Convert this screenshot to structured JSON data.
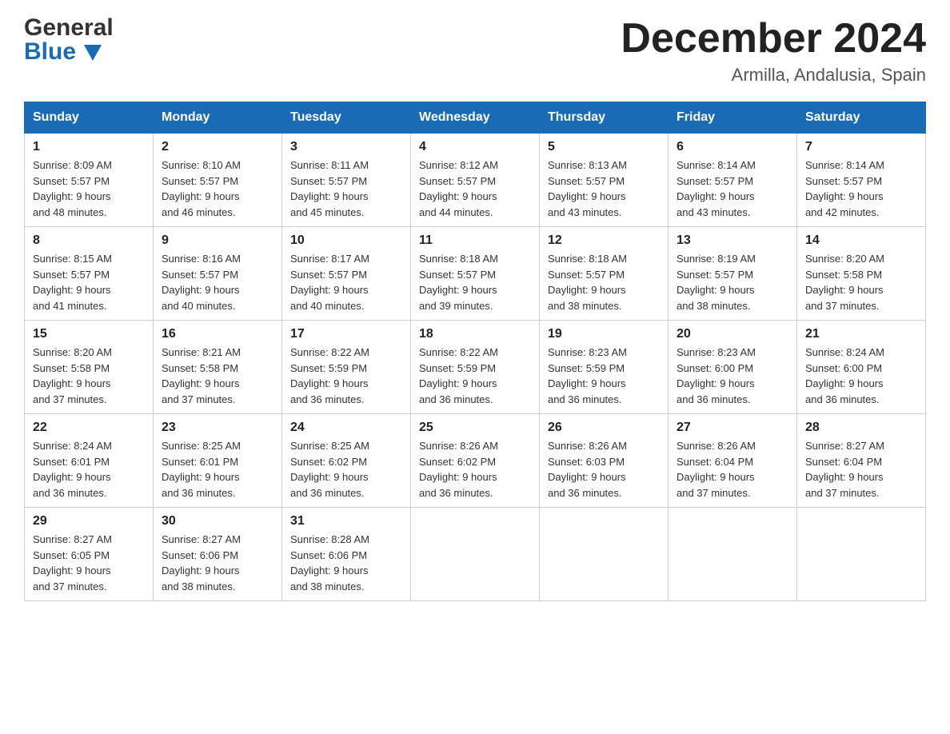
{
  "logo": {
    "line1": "General",
    "line2": "Blue"
  },
  "title": "December 2024",
  "subtitle": "Armilla, Andalusia, Spain",
  "days_of_week": [
    "Sunday",
    "Monday",
    "Tuesday",
    "Wednesday",
    "Thursday",
    "Friday",
    "Saturday"
  ],
  "weeks": [
    [
      {
        "day": "1",
        "sunrise": "8:09 AM",
        "sunset": "5:57 PM",
        "daylight": "9 hours and 48 minutes."
      },
      {
        "day": "2",
        "sunrise": "8:10 AM",
        "sunset": "5:57 PM",
        "daylight": "9 hours and 46 minutes."
      },
      {
        "day": "3",
        "sunrise": "8:11 AM",
        "sunset": "5:57 PM",
        "daylight": "9 hours and 45 minutes."
      },
      {
        "day": "4",
        "sunrise": "8:12 AM",
        "sunset": "5:57 PM",
        "daylight": "9 hours and 44 minutes."
      },
      {
        "day": "5",
        "sunrise": "8:13 AM",
        "sunset": "5:57 PM",
        "daylight": "9 hours and 43 minutes."
      },
      {
        "day": "6",
        "sunrise": "8:14 AM",
        "sunset": "5:57 PM",
        "daylight": "9 hours and 43 minutes."
      },
      {
        "day": "7",
        "sunrise": "8:14 AM",
        "sunset": "5:57 PM",
        "daylight": "9 hours and 42 minutes."
      }
    ],
    [
      {
        "day": "8",
        "sunrise": "8:15 AM",
        "sunset": "5:57 PM",
        "daylight": "9 hours and 41 minutes."
      },
      {
        "day": "9",
        "sunrise": "8:16 AM",
        "sunset": "5:57 PM",
        "daylight": "9 hours and 40 minutes."
      },
      {
        "day": "10",
        "sunrise": "8:17 AM",
        "sunset": "5:57 PM",
        "daylight": "9 hours and 40 minutes."
      },
      {
        "day": "11",
        "sunrise": "8:18 AM",
        "sunset": "5:57 PM",
        "daylight": "9 hours and 39 minutes."
      },
      {
        "day": "12",
        "sunrise": "8:18 AM",
        "sunset": "5:57 PM",
        "daylight": "9 hours and 38 minutes."
      },
      {
        "day": "13",
        "sunrise": "8:19 AM",
        "sunset": "5:57 PM",
        "daylight": "9 hours and 38 minutes."
      },
      {
        "day": "14",
        "sunrise": "8:20 AM",
        "sunset": "5:58 PM",
        "daylight": "9 hours and 37 minutes."
      }
    ],
    [
      {
        "day": "15",
        "sunrise": "8:20 AM",
        "sunset": "5:58 PM",
        "daylight": "9 hours and 37 minutes."
      },
      {
        "day": "16",
        "sunrise": "8:21 AM",
        "sunset": "5:58 PM",
        "daylight": "9 hours and 37 minutes."
      },
      {
        "day": "17",
        "sunrise": "8:22 AM",
        "sunset": "5:59 PM",
        "daylight": "9 hours and 36 minutes."
      },
      {
        "day": "18",
        "sunrise": "8:22 AM",
        "sunset": "5:59 PM",
        "daylight": "9 hours and 36 minutes."
      },
      {
        "day": "19",
        "sunrise": "8:23 AM",
        "sunset": "5:59 PM",
        "daylight": "9 hours and 36 minutes."
      },
      {
        "day": "20",
        "sunrise": "8:23 AM",
        "sunset": "6:00 PM",
        "daylight": "9 hours and 36 minutes."
      },
      {
        "day": "21",
        "sunrise": "8:24 AM",
        "sunset": "6:00 PM",
        "daylight": "9 hours and 36 minutes."
      }
    ],
    [
      {
        "day": "22",
        "sunrise": "8:24 AM",
        "sunset": "6:01 PM",
        "daylight": "9 hours and 36 minutes."
      },
      {
        "day": "23",
        "sunrise": "8:25 AM",
        "sunset": "6:01 PM",
        "daylight": "9 hours and 36 minutes."
      },
      {
        "day": "24",
        "sunrise": "8:25 AM",
        "sunset": "6:02 PM",
        "daylight": "9 hours and 36 minutes."
      },
      {
        "day": "25",
        "sunrise": "8:26 AM",
        "sunset": "6:02 PM",
        "daylight": "9 hours and 36 minutes."
      },
      {
        "day": "26",
        "sunrise": "8:26 AM",
        "sunset": "6:03 PM",
        "daylight": "9 hours and 36 minutes."
      },
      {
        "day": "27",
        "sunrise": "8:26 AM",
        "sunset": "6:04 PM",
        "daylight": "9 hours and 37 minutes."
      },
      {
        "day": "28",
        "sunrise": "8:27 AM",
        "sunset": "6:04 PM",
        "daylight": "9 hours and 37 minutes."
      }
    ],
    [
      {
        "day": "29",
        "sunrise": "8:27 AM",
        "sunset": "6:05 PM",
        "daylight": "9 hours and 37 minutes."
      },
      {
        "day": "30",
        "sunrise": "8:27 AM",
        "sunset": "6:06 PM",
        "daylight": "9 hours and 38 minutes."
      },
      {
        "day": "31",
        "sunrise": "8:28 AM",
        "sunset": "6:06 PM",
        "daylight": "9 hours and 38 minutes."
      },
      null,
      null,
      null,
      null
    ]
  ],
  "labels": {
    "sunrise": "Sunrise:",
    "sunset": "Sunset:",
    "daylight": "Daylight:"
  }
}
